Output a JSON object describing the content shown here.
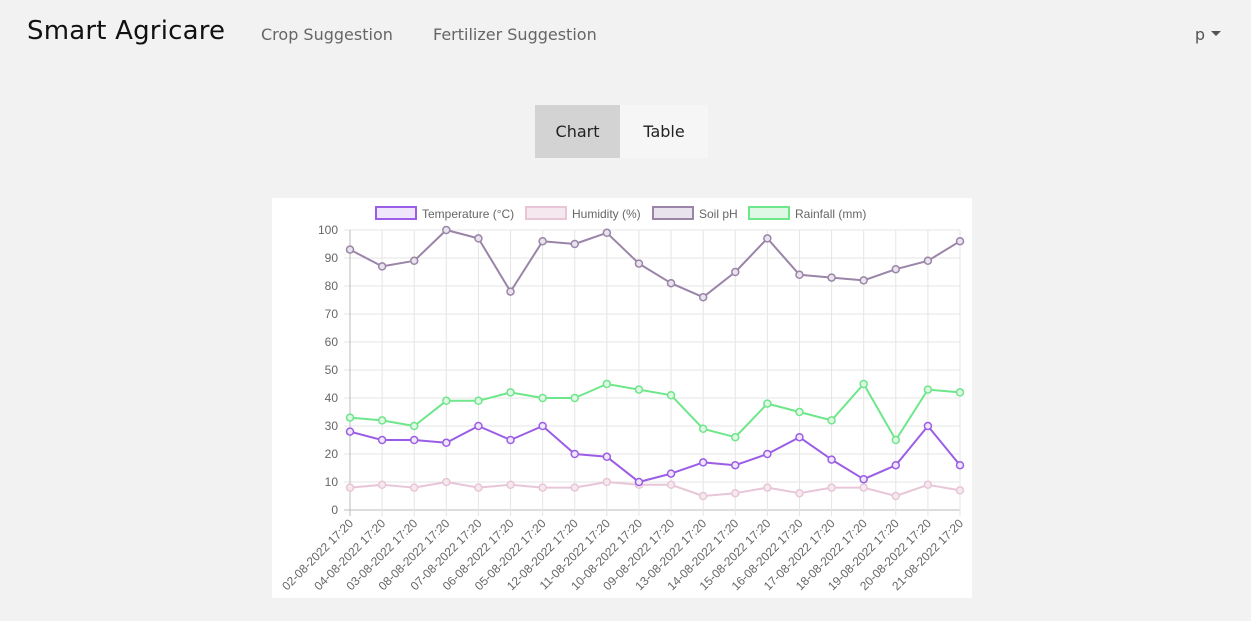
{
  "nav": {
    "brand": "Smart Agricare",
    "links": [
      "Crop Suggestion",
      "Fertilizer Suggestion"
    ],
    "user": "p"
  },
  "toggle": {
    "chart_label": "Chart",
    "table_label": "Table",
    "active": "Chart"
  },
  "colors": {
    "temperature": "#9b5de5",
    "humidity": "#e8c6d8",
    "soil_ph": "#9a85a8",
    "rainfall": "#6ee68a",
    "active_toggle_bg": "#d3d3d3"
  },
  "chart_data": {
    "type": "line",
    "categories": [
      "02-08-2022 17:20",
      "04-08-2022 17:20",
      "03-08-2022 17:20",
      "08-08-2022 17:20",
      "07-08-2022 17:20",
      "06-08-2022 17:20",
      "05-08-2022 17:20",
      "12-08-2022 17:20",
      "11-08-2022 17:20",
      "10-08-2022 17:20",
      "09-08-2022 17:20",
      "13-08-2022 17:20",
      "14-08-2022 17:20",
      "15-08-2022 17:20",
      "16-08-2022 17:20",
      "17-08-2022 17:20",
      "18-08-2022 17:20",
      "19-08-2022 17:20",
      "20-08-2022 17:20",
      "21-08-2022 17:20"
    ],
    "ylim": [
      0,
      100
    ],
    "yticks": [
      0,
      10,
      20,
      30,
      40,
      50,
      60,
      70,
      80,
      90,
      100
    ],
    "legend_position": "top",
    "grid": true,
    "series": [
      {
        "name": "Temperature (°C)",
        "color": "#9b5de5",
        "fill": "#efe6fb",
        "values": [
          28,
          25,
          25,
          24,
          30,
          25,
          30,
          20,
          19,
          10,
          13,
          17,
          16,
          20,
          26,
          18,
          11,
          16,
          30,
          16
        ]
      },
      {
        "name": "Humidity (%)",
        "color": "#e8c6d8",
        "fill": "#f5e8ef",
        "values": [
          8,
          9,
          8,
          10,
          8,
          9,
          8,
          8,
          10,
          9,
          9,
          5,
          6,
          8,
          6,
          8,
          8,
          5,
          9,
          7
        ]
      },
      {
        "name": "Soil pH",
        "color": "#9a85a8",
        "fill": "#e8e3ec",
        "values": [
          93,
          87,
          89,
          100,
          97,
          78,
          96,
          95,
          99,
          88,
          81,
          76,
          85,
          97,
          84,
          83,
          82,
          86,
          89,
          96
        ]
      },
      {
        "name": "Rainfall (mm)",
        "color": "#6ee68a",
        "fill": "#dff7e5",
        "values": [
          33,
          32,
          30,
          39,
          39,
          42,
          40,
          40,
          45,
          43,
          41,
          29,
          26,
          38,
          35,
          32,
          45,
          25,
          43,
          42
        ]
      }
    ]
  }
}
